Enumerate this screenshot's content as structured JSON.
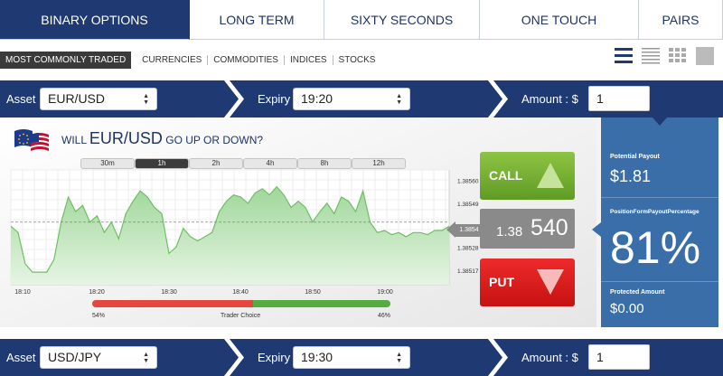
{
  "tabs": [
    {
      "label": "BINARY OPTIONS",
      "active": true
    },
    {
      "label": "LONG TERM",
      "active": false
    },
    {
      "label": "SIXTY SECONDS",
      "active": false
    },
    {
      "label": "ONE TOUCH",
      "active": false
    },
    {
      "label": "PAIRS",
      "active": false
    }
  ],
  "subnav": [
    "MOST COMMONLY TRADED",
    "CURRENCIES",
    "COMMODITIES",
    "INDICES",
    "STOCKS"
  ],
  "view_icons": [
    "list-view-icon",
    "compact-list-icon",
    "grid-view-icon",
    "tile-view-icon"
  ],
  "row1": {
    "asset_label": "Asset :",
    "asset_value": "EUR/USD",
    "expiry_label": "Expiry :",
    "expiry_value": "19:20",
    "amount_label": "Amount : $",
    "amount_value": "1"
  },
  "row2": {
    "asset_label": "Asset :",
    "asset_value": "USD/JPY",
    "expiry_label": "Expiry :",
    "expiry_value": "19:30",
    "amount_label": "Amount : $",
    "amount_value": "1"
  },
  "question": {
    "prefix": "WILL",
    "pair": "EUR/USD",
    "suffix": "GO UP OR DOWN?"
  },
  "timeframes": [
    {
      "label": "30m",
      "active": false
    },
    {
      "label": "1h",
      "active": true
    },
    {
      "label": "2h",
      "active": false
    },
    {
      "label": "4h",
      "active": false
    },
    {
      "label": "8h",
      "active": false
    },
    {
      "label": "12h",
      "active": false
    }
  ],
  "call_label": "CALL",
  "put_label": "PUT",
  "price": {
    "small": "1.38",
    "big": "540",
    "tag": "1.3854"
  },
  "sentiment": {
    "put_pct": "54%",
    "label": "Trader Choice",
    "call_pct": "46%",
    "put_fraction": 0.54
  },
  "payout": {
    "potential_label": "Potential Payout",
    "potential_value": "$1.81",
    "pct_label": "PositionFormPayoutPercentage",
    "pct_value": "81%",
    "protected_label": "Protected Amount",
    "protected_value": "$0.00"
  },
  "colors": {
    "navy": "#1f3a73",
    "payout_blue": "#3a6ea9",
    "call_green": "#6aab2c",
    "put_red": "#d81a1a"
  },
  "chart_data": {
    "type": "area",
    "x_ticks": [
      "18:10",
      "18:20",
      "18:30",
      "18:40",
      "18:50",
      "19:00"
    ],
    "y_ticks": [
      "1.38560",
      "1.38549",
      "1.38538",
      "1.38528",
      "1.38517"
    ],
    "ylim": [
      1.3851,
      1.38565
    ],
    "current_price": 1.3854,
    "values": [
      1.38538,
      1.38535,
      1.3852,
      1.38516,
      1.38516,
      1.38516,
      1.38522,
      1.3854,
      1.38552,
      1.38545,
      1.38548,
      1.3854,
      1.38543,
      1.38535,
      1.3854,
      1.38532,
      1.38544,
      1.3855,
      1.38555,
      1.38552,
      1.38547,
      1.38544,
      1.38525,
      1.38528,
      1.38537,
      1.38533,
      1.38531,
      1.38533,
      1.38535,
      1.38545,
      1.3855,
      1.38553,
      1.38552,
      1.38549,
      1.38554,
      1.38556,
      1.38553,
      1.38557,
      1.38553,
      1.38547,
      1.3855,
      1.38547,
      1.3854,
      1.38545,
      1.38549,
      1.38544,
      1.38552,
      1.3855,
      1.38545,
      1.38555,
      1.3854,
      1.38535,
      1.38536,
      1.38534,
      1.38535,
      1.38533,
      1.38535,
      1.38535,
      1.38534,
      1.38536,
      1.38536,
      1.38538
    ]
  }
}
